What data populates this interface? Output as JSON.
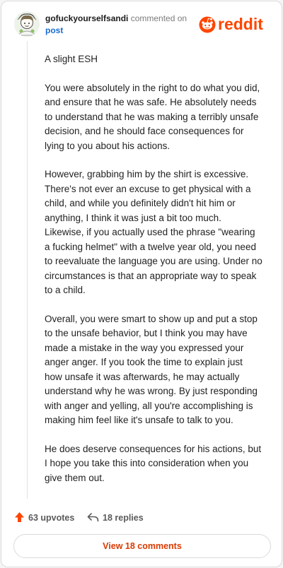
{
  "header": {
    "username": "gofuckyourselfsandi",
    "action_text": "commented on",
    "post_link": "post",
    "logo_text": "reddit"
  },
  "comment": {
    "paragraphs": [
      "A slight ESH",
      "You were absolutely in the right to do what you did, and ensure that he was safe. He absolutely needs to understand that he was making a terribly unsafe decision, and he should face consequences for lying to you about his actions.",
      "However, grabbing him by the shirt is excessive. There's not ever an excuse to get physical with a child, and while you definitely didn't hit him or anything, I think it was just a bit too much. Likewise, if you actually used the phrase \"wearing a fucking helmet\" with a twelve year old, you need to reevaluate the language you are using. Under no circumstances is that an appropriate way to speak to a child.",
      "Overall, you were smart to show up and put a stop to the unsafe behavior, but I think you may have made a mistake in the way you expressed your anger anger. If you took the time to explain just how unsafe it was afterwards, he may actually understand why he was wrong. By just responding with anger and yelling, all you're accomplishing is making him feel like it's unsafe to talk to you.",
      "He does deserve consequences for his actions, but I hope you take this into consideration when you give them out."
    ]
  },
  "actions": {
    "upvotes_label": "63 upvotes",
    "replies_label": "18 replies",
    "upvote_icon": "upvote-arrow-icon",
    "reply_icon": "reply-arrow-icon"
  },
  "footer": {
    "view_comments_label": "View 18 comments"
  },
  "colors": {
    "brand": "#ff4500",
    "link": "#1a6ccf",
    "view_button_text": "#d93a00"
  }
}
